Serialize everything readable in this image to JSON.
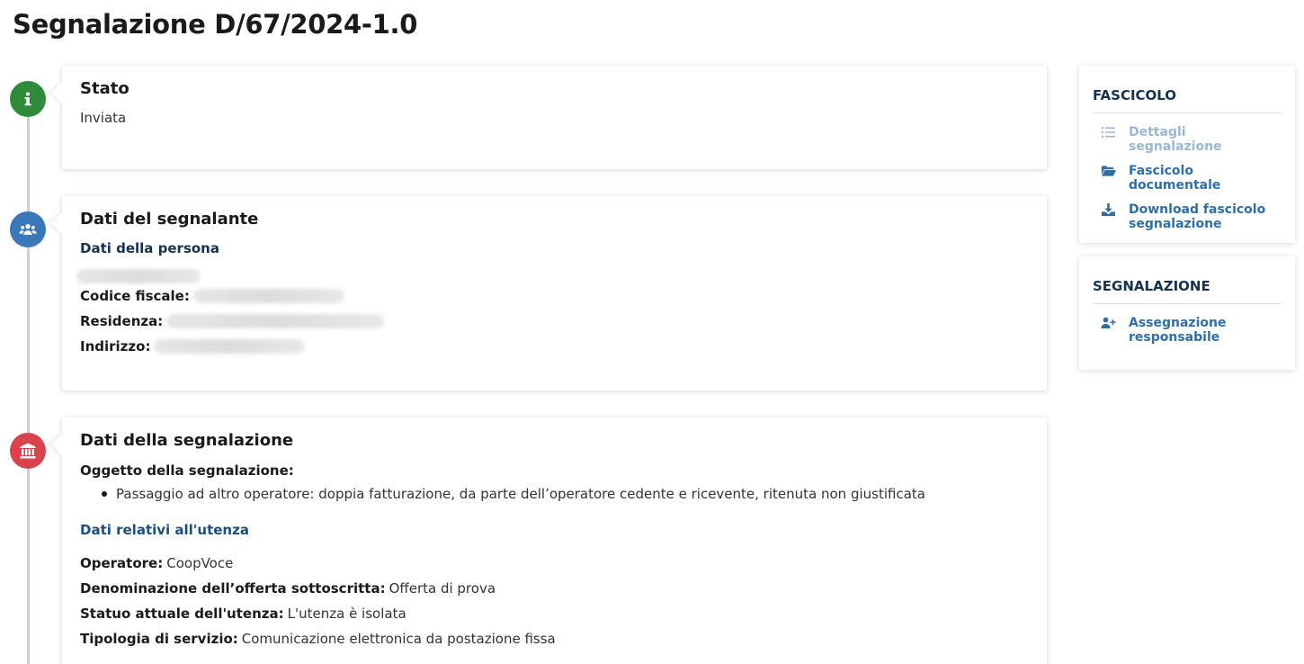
{
  "page": {
    "title": "Segnalazione D/67/2024-1.0"
  },
  "stato": {
    "title": "Stato",
    "value": "Inviata"
  },
  "segnalante": {
    "title": "Dati del segnalante",
    "subtitle": "Dati della persona",
    "fields": [
      {
        "label": "Codice fiscale:"
      },
      {
        "label": "Residenza:"
      },
      {
        "label": "Indirizzo:"
      }
    ]
  },
  "segnalazione": {
    "title": "Dati della segnalazione",
    "oggetto_label": "Oggetto della segnalazione:",
    "oggetto_items": [
      "Passaggio ad altro operatore: doppia fatturazione, da parte dell’operatore cedente e ricevente, ritenuta non giustificata"
    ],
    "utenza_title": "Dati relativi all'utenza",
    "fields": [
      {
        "label": "Operatore:",
        "value": "CoopVoce"
      },
      {
        "label": "Denominazione dell’offerta sottoscritta:",
        "value": "Offerta di prova"
      },
      {
        "label": "Statuo attuale dell'utenza:",
        "value": "L'utenza è isolata"
      },
      {
        "label": "Tipologia di servizio:",
        "value": "Comunicazione elettronica da postazione fissa"
      }
    ]
  },
  "sidebar": {
    "fascicolo": {
      "title": "FASCICOLO",
      "links": [
        {
          "label": "Dettagli segnalazione",
          "icon": "list-icon",
          "disabled": true
        },
        {
          "label": "Fascicolo documentale",
          "icon": "folder-open-icon"
        },
        {
          "label": "Download fascicolo segnalazione",
          "icon": "download-icon"
        }
      ]
    },
    "segnalazione": {
      "title": "SEGNALAZIONE",
      "links": [
        {
          "label": "Assegnazione responsabile",
          "icon": "user-plus-icon"
        }
      ]
    }
  },
  "colors": {
    "stato_icon": "#2e8b3a",
    "segnalante_icon": "#3a78b9",
    "segnalazione_icon": "#d9434b",
    "link": "#2f6fa8",
    "link_disabled": "#9bb8d3",
    "heading_blue": "#17324d"
  }
}
